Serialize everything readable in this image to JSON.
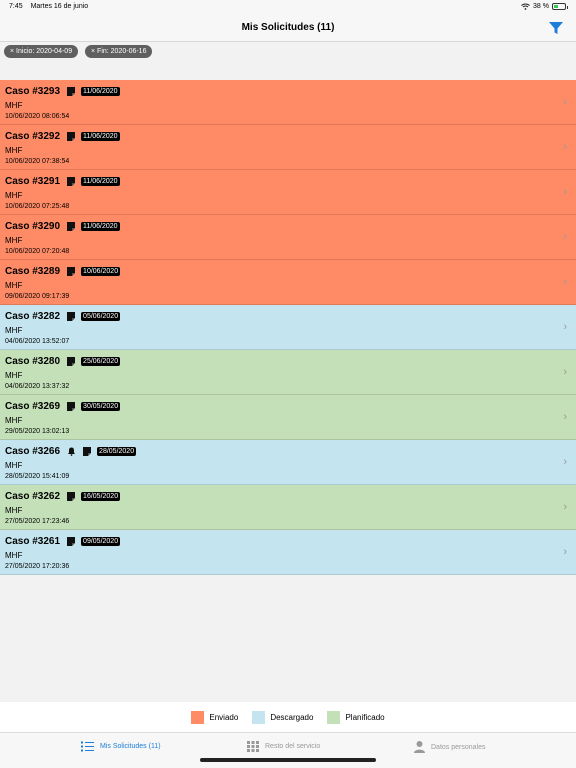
{
  "status_bar": {
    "time": "7:45",
    "date": "Martes 16 de junio",
    "battery": "38 %",
    "battery_level": 0.38
  },
  "nav": {
    "title": "Mis Solicitudes (11)",
    "filter_icon": "filter-icon"
  },
  "filters": [
    {
      "label": "Inicio: 2020-04-09",
      "remove_glyph": "×"
    },
    {
      "label": "Fin: 2020-06-16",
      "remove_glyph": "×"
    }
  ],
  "colors": {
    "enviado": "#ff8a66",
    "descargado": "#c4e5ef",
    "planificado": "#c4e0b8",
    "accent": "#1d7ed8"
  },
  "requests": [
    {
      "title": "Caso #3293",
      "badge": "11/06/2020",
      "bell": false,
      "subtitle": "MHF",
      "timestamp": "10/06/2020  08:06:54",
      "status": "enviado"
    },
    {
      "title": "Caso #3292",
      "badge": "11/06/2020",
      "bell": false,
      "subtitle": "MHF",
      "timestamp": "10/06/2020  07:38:54",
      "status": "enviado"
    },
    {
      "title": "Caso #3291",
      "badge": "11/06/2020",
      "bell": false,
      "subtitle": "MHF",
      "timestamp": "10/06/2020  07:25:48",
      "status": "enviado"
    },
    {
      "title": "Caso #3290",
      "badge": "11/06/2020",
      "bell": false,
      "subtitle": "MHF",
      "timestamp": "10/06/2020  07:20:48",
      "status": "enviado"
    },
    {
      "title": "Caso #3289",
      "badge": "10/06/2020",
      "bell": false,
      "subtitle": "MHF",
      "timestamp": "09/06/2020  09:17:39",
      "status": "enviado"
    },
    {
      "title": "Caso #3282",
      "badge": "05/06/2020",
      "bell": false,
      "subtitle": "MHF",
      "timestamp": "04/06/2020  13:52:07",
      "status": "descargado"
    },
    {
      "title": "Caso #3280",
      "badge": "25/06/2020",
      "bell": false,
      "subtitle": "MHF",
      "timestamp": "04/06/2020  13:37:32",
      "status": "planificado"
    },
    {
      "title": "Caso #3269",
      "badge": "30/05/2020",
      "bell": false,
      "subtitle": "MHF",
      "timestamp": "29/05/2020  13:02:13",
      "status": "planificado"
    },
    {
      "title": "Caso #3266",
      "badge": "28/05/2020",
      "bell": true,
      "subtitle": "MHF",
      "timestamp": "28/05/2020  15:41:09",
      "status": "descargado"
    },
    {
      "title": "Caso #3262",
      "badge": "16/05/2020",
      "bell": false,
      "subtitle": "MHF",
      "timestamp": "27/05/2020  17:23:46",
      "status": "planificado"
    },
    {
      "title": "Caso #3261",
      "badge": "09/05/2020",
      "bell": false,
      "subtitle": "MHF",
      "timestamp": "27/05/2020  17:20:36",
      "status": "descargado"
    }
  ],
  "legend": [
    {
      "label": "Enviado",
      "status": "enviado"
    },
    {
      "label": "Descargado",
      "status": "descargado"
    },
    {
      "label": "Planificado",
      "status": "planificado"
    }
  ],
  "tabs": [
    {
      "label": "Mis Solicitudes (11)",
      "icon": "list-icon",
      "active": true
    },
    {
      "label": "Resto del servicio",
      "icon": "grid-icon",
      "active": false
    },
    {
      "label": "Datos personales",
      "icon": "person-icon",
      "active": false
    }
  ]
}
